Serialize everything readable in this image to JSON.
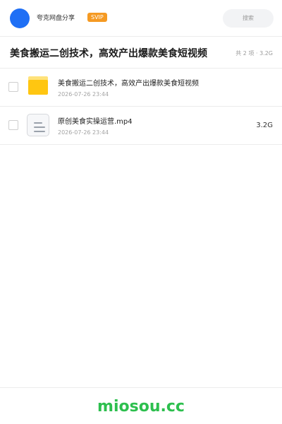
{
  "header": {
    "sharer_name": "夸克网盘分享",
    "badge": "SVIP",
    "search_label": "搜索"
  },
  "share": {
    "title": "美食搬运二创技术，高效产出爆款美食短视频",
    "summary": "共 2 项 · 3.2G"
  },
  "files": [
    {
      "name": "美食搬运二创技术，高效产出爆款美食短视频",
      "date": "2026-07-26 23:44",
      "size": "",
      "icon": "folder-icon"
    },
    {
      "name": "原创美食实操运营.mp4",
      "date": "2026-07-26 23:44",
      "size": "3.2G",
      "icon": "file-icon"
    }
  ],
  "footer": {
    "brand": "miosou.cc"
  },
  "colors": {
    "accent": "#1f6ff5",
    "badge": "#f59a23",
    "brand": "#2dbf4e",
    "folder": "#ffc611"
  }
}
